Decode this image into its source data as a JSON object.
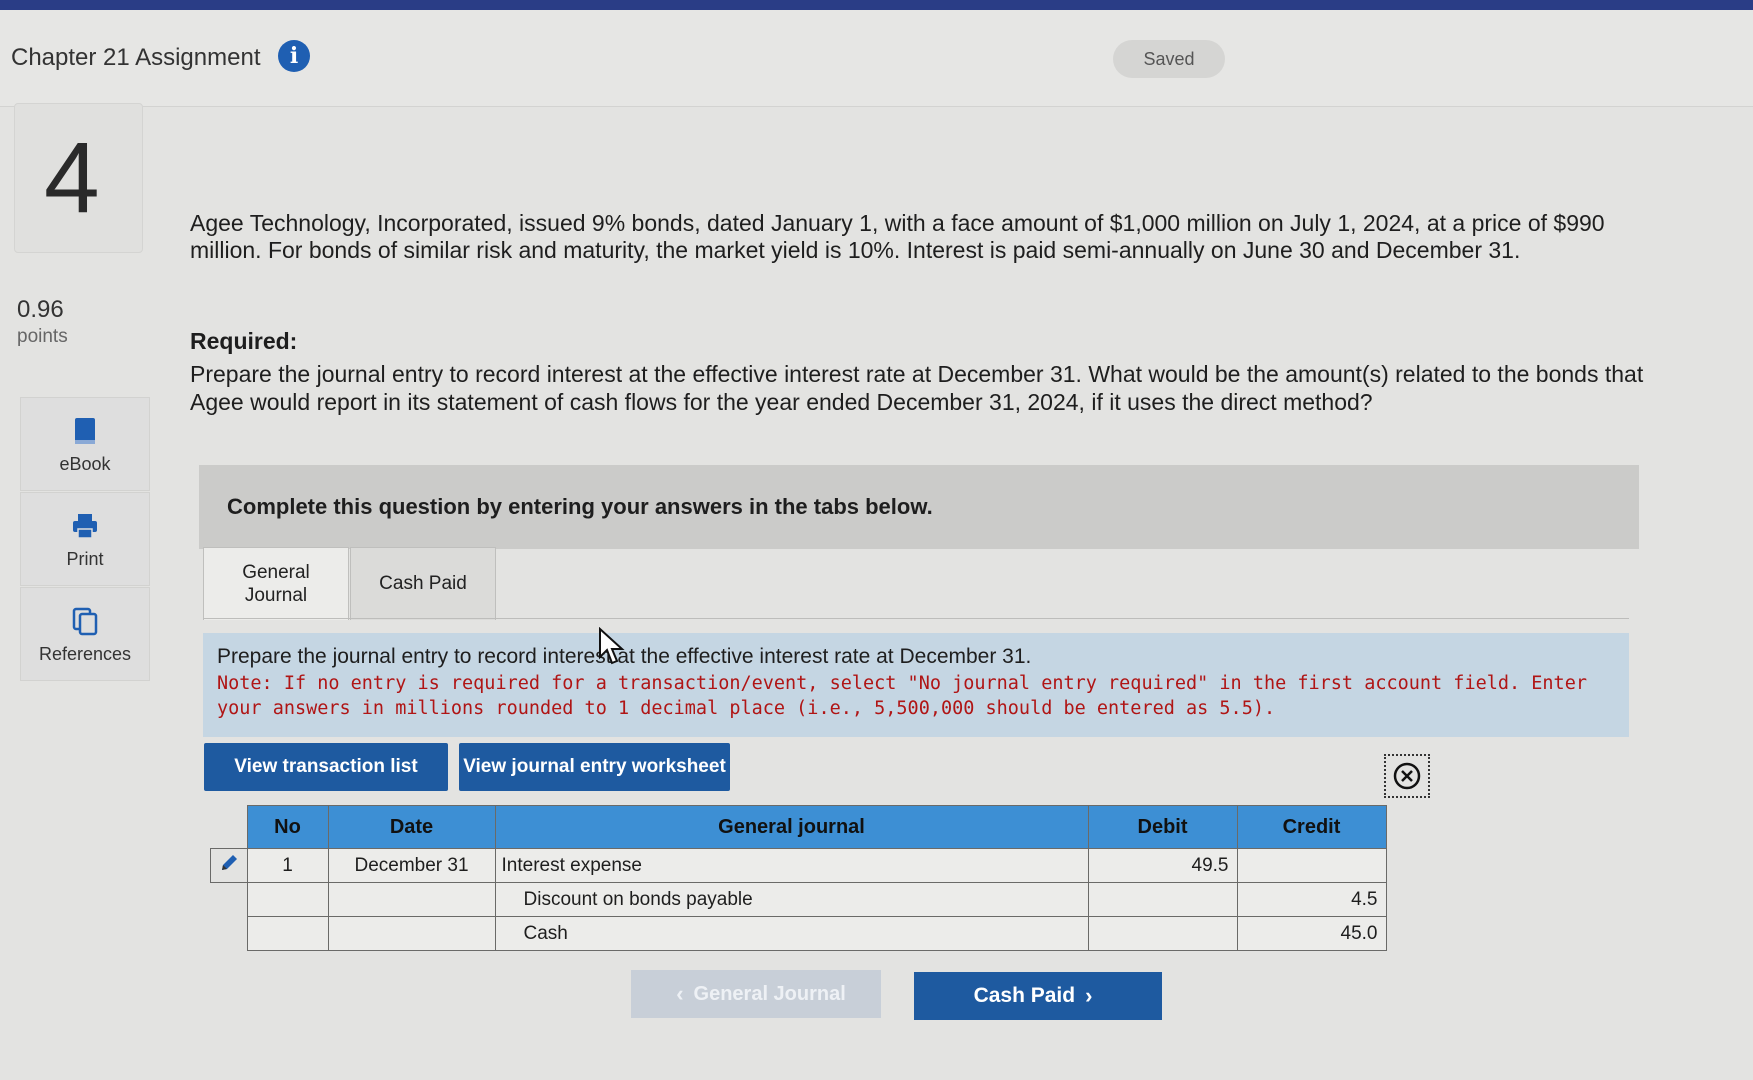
{
  "header": {
    "title": "Chapter 21 Assignment",
    "status": "Saved"
  },
  "question": {
    "number": "4",
    "points_value": "0.96",
    "points_label": "points"
  },
  "side_tools": [
    {
      "label": "eBook",
      "icon": "book-icon"
    },
    {
      "label": "Print",
      "icon": "printer-icon"
    },
    {
      "label": "References",
      "icon": "copy-icon"
    }
  ],
  "problem": {
    "text": "Agee Technology, Incorporated, issued 9% bonds, dated January 1, with a face amount of $1,000 million on July 1, 2024, at a price of $990 million. For bonds of similar risk and maturity, the market yield is 10%. Interest is paid semi-annually on June 30 and December 31.",
    "required_label": "Required:",
    "required_text": "Prepare the journal entry to record interest at the effective interest rate at December 31. What would be the amount(s) related to the bonds that Agee would report in its statement of cash flows for the year ended December 31, 2024, if it uses the direct method?"
  },
  "banner": "Complete this question by entering your answers in the tabs below.",
  "tabs": [
    {
      "label": "General Journal",
      "active": true
    },
    {
      "label": "Cash Paid",
      "active": false
    }
  ],
  "instructions": {
    "line1": "Prepare the journal entry to record interest at the effective interest rate at December 31.",
    "note": "Note: If no entry is required for a transaction/event, select \"No journal entry required\" in the first account field. Enter your answers in millions rounded to 1 decimal place (i.e., 5,500,000 should be entered as 5.5)."
  },
  "buttons": {
    "view_transaction_list": "View transaction list",
    "view_journal_worksheet": "View journal entry worksheet"
  },
  "journal": {
    "headers": {
      "no": "No",
      "date": "Date",
      "account": "General journal",
      "debit": "Debit",
      "credit": "Credit"
    },
    "rows": [
      {
        "no": "1",
        "date": "December 31",
        "account": "Interest expense",
        "debit": "49.5",
        "credit": ""
      },
      {
        "no": "",
        "date": "",
        "account": "Discount on bonds payable",
        "debit": "",
        "credit": "4.5"
      },
      {
        "no": "",
        "date": "",
        "account": "Cash",
        "debit": "",
        "credit": "45.0"
      }
    ]
  },
  "navigation": {
    "prev_label": "General Journal",
    "next_label": "Cash Paid"
  },
  "colors": {
    "accent_blue": "#1e5aa0",
    "table_header_blue": "#3d8fd4",
    "note_red": "#b01515"
  }
}
